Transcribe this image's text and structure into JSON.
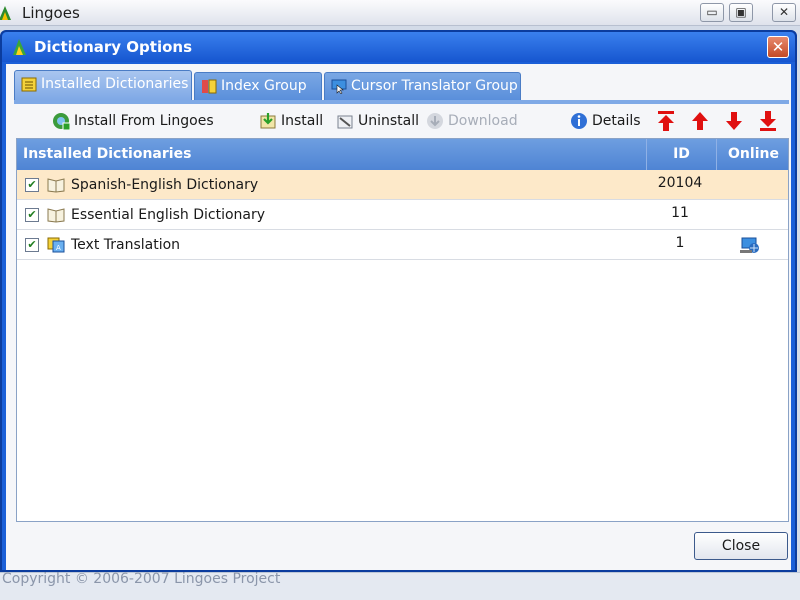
{
  "app": {
    "title": "Lingoes"
  },
  "window_controls": {
    "minimize": "▭",
    "maximize": "▣",
    "close": "✕"
  },
  "dialog": {
    "title": "Dictionary Options",
    "close_symbol": "✕",
    "tabs": [
      {
        "label": "Installed Dictionaries",
        "icon": "dictionary-list-icon",
        "active": true
      },
      {
        "label": "Index Group",
        "icon": "index-group-icon",
        "active": false
      },
      {
        "label": "Cursor Translator Group",
        "icon": "cursor-translator-icon",
        "active": false
      }
    ],
    "toolbar": {
      "install_from": "Install From Lingoes",
      "install": "Install",
      "uninstall": "Uninstall",
      "download": "Download",
      "details": "Details"
    },
    "table": {
      "headers": {
        "name": "Installed Dictionaries",
        "id": "ID",
        "online": "Online"
      },
      "rows": [
        {
          "checked": true,
          "name": "Spanish-English Dictionary",
          "id": "20104",
          "online": false,
          "icon": "book-icon"
        },
        {
          "checked": true,
          "name": "Essential English Dictionary",
          "id": "11",
          "online": false,
          "icon": "book-icon"
        },
        {
          "checked": true,
          "name": "Text Translation",
          "id": "1",
          "online": true,
          "icon": "translation-icon"
        }
      ]
    },
    "close_button": "Close"
  },
  "status": {
    "copyright": "Copyright © 2006-2007 Lingoes Project"
  },
  "colors": {
    "accent": "#1a5fd8",
    "header": "#4f84d4",
    "selected_row": "#fde9c9",
    "arrow": "#e01010"
  }
}
